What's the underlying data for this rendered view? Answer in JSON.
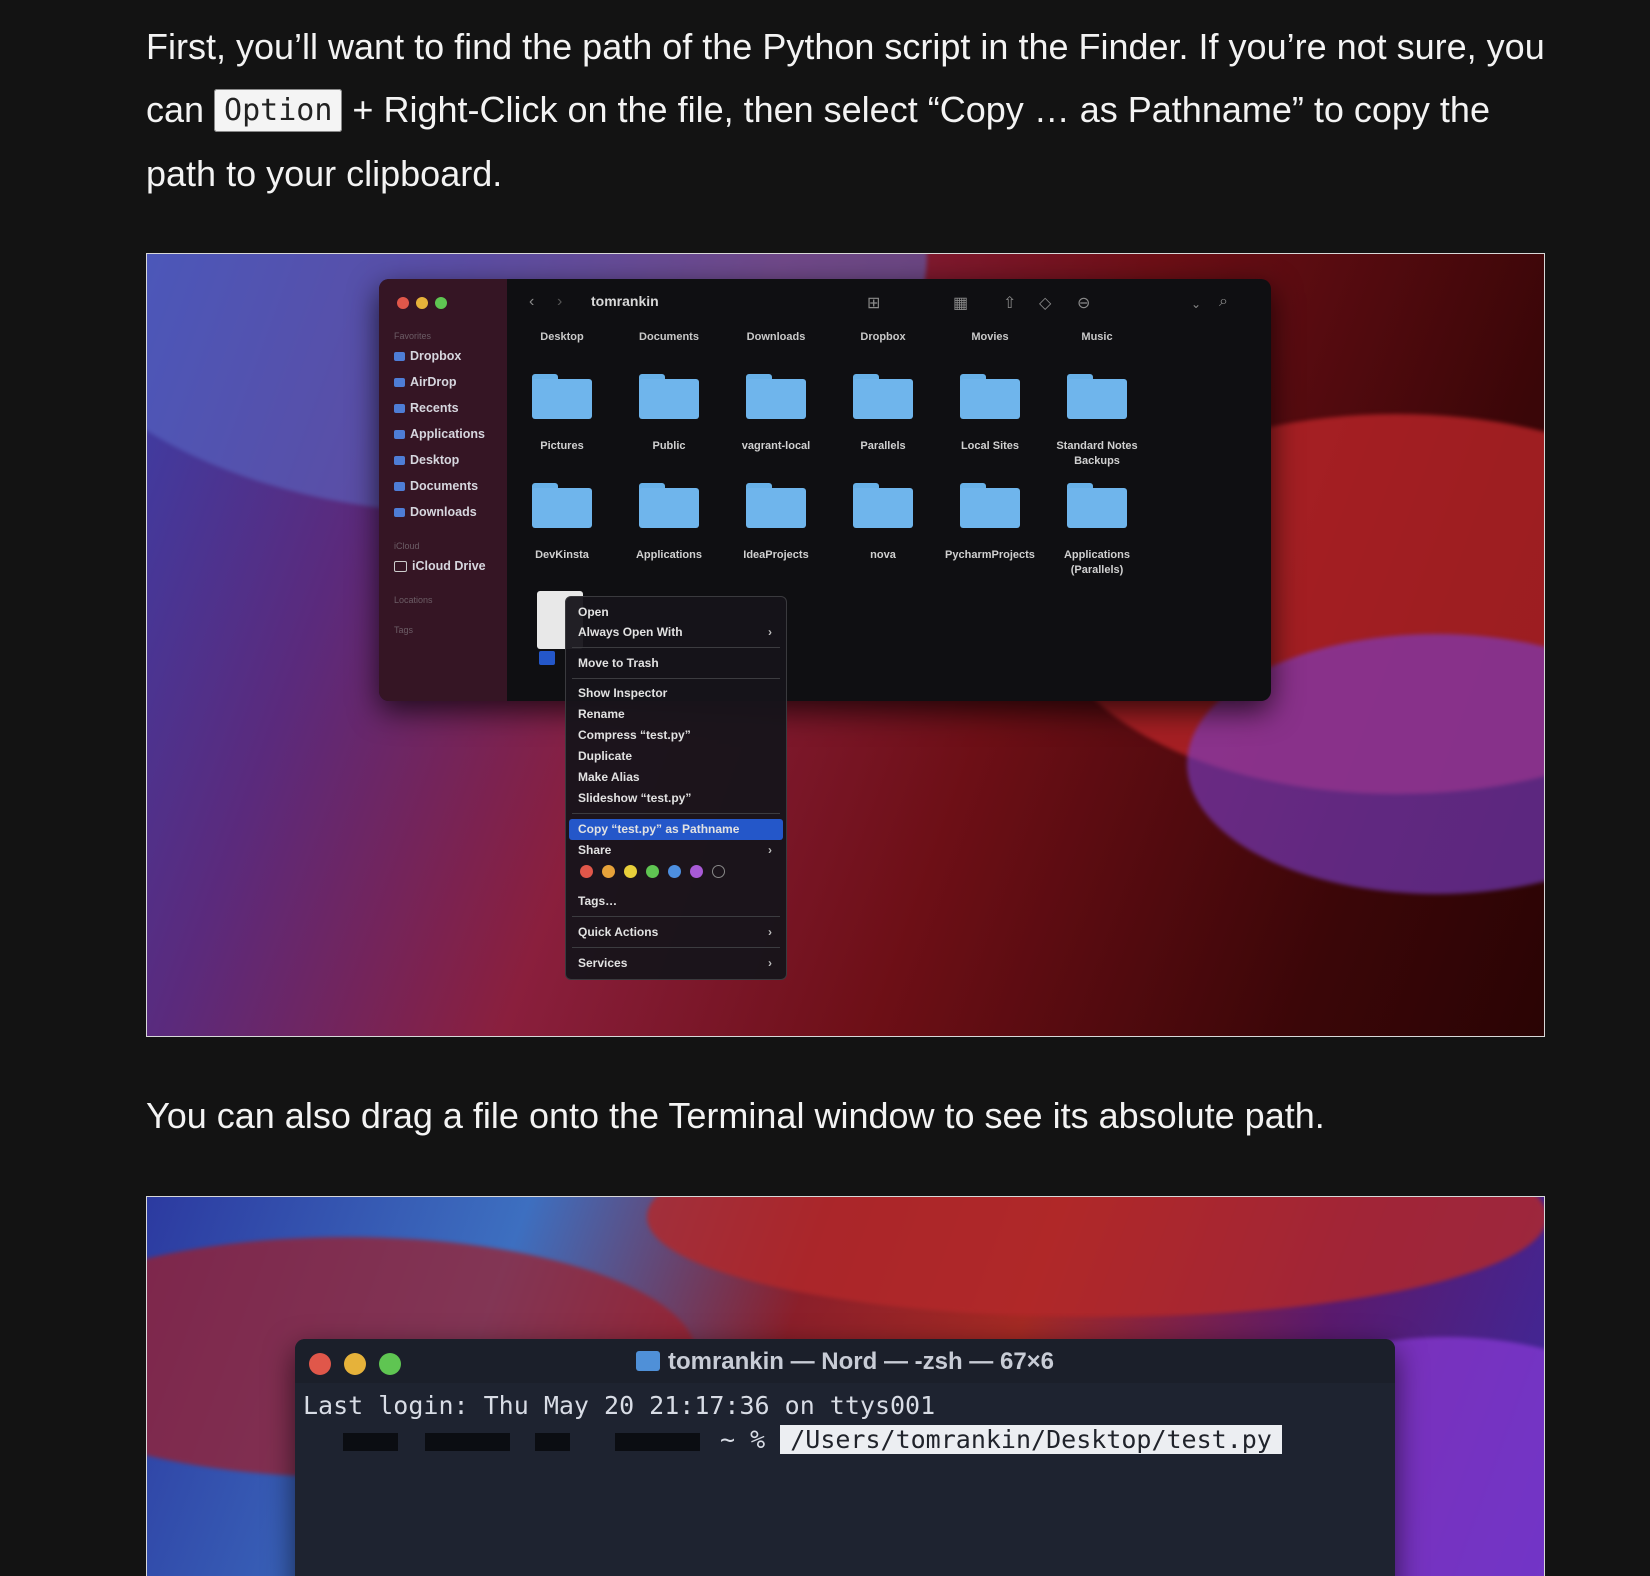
{
  "intro": {
    "before": "First, you’ll want to find the path of the Python script in the Finder. If you’re not sure, you can ",
    "key": "Option",
    "after": " + Right-Click on the file, then select “Copy … as Pathname” to copy the path to your clipboard."
  },
  "drag_text": "You can also drag a file onto the Terminal window to see its absolute path.",
  "finder": {
    "title": "tomrankin",
    "sidebar": {
      "favorites_label": "Favorites",
      "items": [
        "Dropbox",
        "AirDrop",
        "Recents",
        "Applications",
        "Desktop",
        "Documents",
        "Downloads"
      ],
      "icloud_label": "iCloud",
      "icloud_drive": "iCloud Drive",
      "locations_label": "Locations",
      "tags_label": "Tags"
    },
    "headers": [
      "Desktop",
      "Documents",
      "Downloads",
      "Dropbox",
      "Movies",
      "Music"
    ],
    "row1": [
      "Pictures",
      "Public",
      "vagrant-local",
      "Parallels",
      "Local Sites",
      "Standard Notes Backups"
    ],
    "row2": [
      "DevKinsta",
      "Applications",
      "IdeaProjects",
      "nova",
      "PycharmProjects",
      "Applications (Parallels)"
    ],
    "context_menu": {
      "open": "Open",
      "always_open_with": "Always Open With",
      "move_to_trash": "Move to Trash",
      "show_inspector": "Show Inspector",
      "rename": "Rename",
      "compress": "Compress “test.py”",
      "duplicate": "Duplicate",
      "make_alias": "Make Alias",
      "slideshow": "Slideshow “test.py”",
      "copy_pathname": "Copy “test.py” as Pathname",
      "share": "Share",
      "tags": "Tags…",
      "quick_actions": "Quick Actions",
      "services": "Services",
      "tag_colors": [
        "#e0574a",
        "#e6a23a",
        "#e8cf3a",
        "#5fc552",
        "#4d8fe0",
        "#a85ad6"
      ]
    }
  },
  "terminal": {
    "title": "tomrankin — Nord — -zsh — 67×6",
    "last_login": "Last login: Thu May 20 21:17:36 on ttys001",
    "prompt": "~ %",
    "path": "/Users/tomrankin/Desktop/test.py"
  },
  "colors": {
    "page_bg": "#131313",
    "highlight": "#2457c9",
    "folder_blue": "#6fb5ec"
  }
}
